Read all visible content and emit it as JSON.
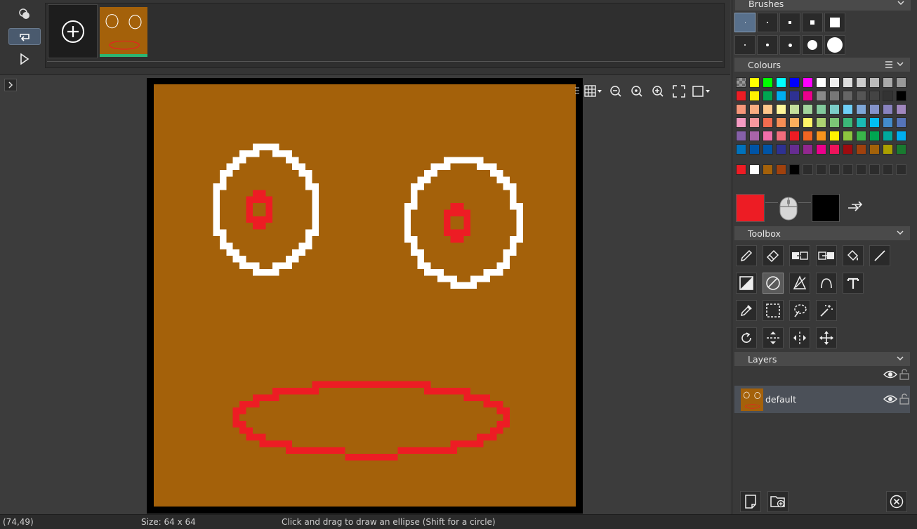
{
  "statusbar": {
    "coords": "(74,49)",
    "size": "Size: 64 x 64",
    "hint": "Click and drag to draw an ellipse (Shift for a circle)"
  },
  "panels": {
    "brushes": "Brushes",
    "colours": "Colours",
    "toolbox": "Toolbox",
    "layers": "Layers"
  },
  "layer": {
    "name": "default"
  },
  "colors": {
    "primary": "#ed1c24",
    "secondary": "#000000",
    "canvas": "#a4610a",
    "eyes": "#ffffff",
    "mouth": "#ed1c24",
    "frame_indicator": "#2bb673"
  },
  "palette": [
    [
      "checker",
      "#ffff00",
      "#00ff00",
      "#00ffff",
      "#0000ff",
      "#ff00ff",
      "#ffffff",
      "#eeeeee",
      "#dddddd",
      "#cccccc",
      "#bbbbbb",
      "#aaaaaa",
      "#999999"
    ],
    [
      "#ed1c24",
      "#fff200",
      "#00a651",
      "#00aeef",
      "#2e3192",
      "#ec008c",
      "#898989",
      "#777777",
      "#666666",
      "#555555",
      "#444444",
      "#333333",
      "#000000"
    ],
    [
      "#f7977a",
      "#f9ad81",
      "#fdc68a",
      "#fff79a",
      "#c4df9b",
      "#a2d39c",
      "#82ca9d",
      "#7bcdc8",
      "#6ecff6",
      "#7ea7d8",
      "#8493ca",
      "#8882be",
      "#a187be"
    ],
    [
      "#f49ac2",
      "#f6989d",
      "#f26c4f",
      "#f68e55",
      "#fbaf5c",
      "#fff467",
      "#acd372",
      "#7cc576",
      "#3bb878",
      "#1abbb4",
      "#00bff3",
      "#438ccb",
      "#5574b9"
    ],
    [
      "#8560a8",
      "#a864a8",
      "#f06eaa",
      "#f26d7d",
      "#ed1c24",
      "#f26522",
      "#f7941d",
      "#fff200",
      "#8dc63f",
      "#39b54a",
      "#00a651",
      "#00a99d",
      "#00aeef"
    ],
    [
      "#0072bc",
      "#0054a6",
      "#0054a6",
      "#2e3192",
      "#662d91",
      "#92278f",
      "#ec008c",
      "#ed145b",
      "#9e0b0f",
      "#a0410d",
      "#a36209",
      "#aba000",
      "#197b30"
    ]
  ],
  "recent_colours": [
    "#ed1c24",
    "#ffffff",
    "#a4610a",
    "#a0410d",
    "#000000",
    "",
    "",
    "",
    "",
    "",
    "",
    "",
    ""
  ],
  "icons": {
    "onion": "onion-skin-icon",
    "loop": "loop-icon",
    "play": "play-icon",
    "add_frame": "add-frame-icon"
  }
}
